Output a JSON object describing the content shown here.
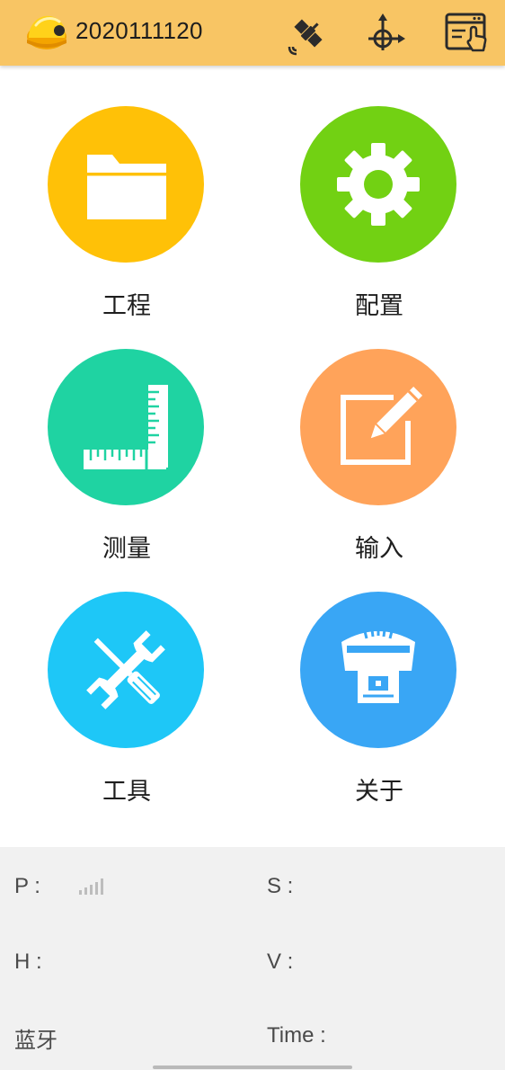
{
  "header": {
    "project_name": "2020111120",
    "icons": [
      "app-logo-helmet-icon",
      "satellite-icon",
      "coordinate-target-icon",
      "window-pointer-icon"
    ]
  },
  "menu": {
    "items": [
      {
        "label": "工程",
        "icon": "folder-icon",
        "color": "#ffc107"
      },
      {
        "label": "配置",
        "icon": "gear-icon",
        "color": "#72d113"
      },
      {
        "label": "测量",
        "icon": "ruler-square-icon",
        "color": "#1fd3a2"
      },
      {
        "label": "输入",
        "icon": "edit-pencil-icon",
        "color": "#ffa35a"
      },
      {
        "label": "工具",
        "icon": "wrench-screwdriver-icon",
        "color": "#1ec7f7"
      },
      {
        "label": "关于",
        "icon": "gnss-receiver-icon",
        "color": "#39a6f5"
      }
    ]
  },
  "status": {
    "p_label": "P :",
    "s_label": "S :",
    "h_label": "H :",
    "v_label": "V :",
    "bluetooth_label": "蓝牙",
    "time_label": "Time :",
    "signal_icon": "signal-bars-icon",
    "signal_bars_active": 0
  }
}
